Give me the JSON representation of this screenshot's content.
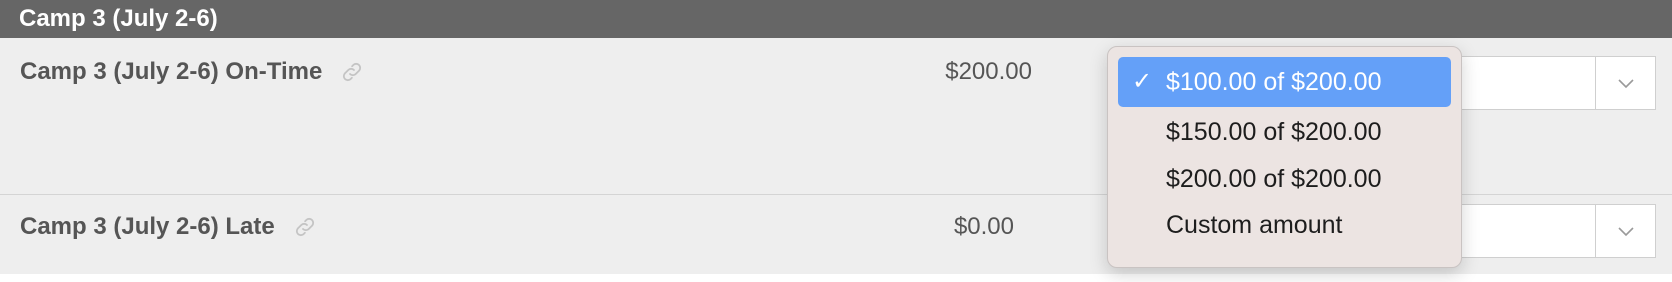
{
  "section": {
    "title": "Camp 3 (July 2-6)"
  },
  "rows": [
    {
      "name": "Camp 3 (July 2-6) On-Time",
      "price": "$200.00"
    },
    {
      "name": "Camp 3 (July 2-6) Late",
      "price": "$0.00"
    }
  ],
  "dropdown": {
    "options": [
      {
        "label": "$100.00 of $200.00",
        "selected": true
      },
      {
        "label": "$150.00 of $200.00",
        "selected": false
      },
      {
        "label": "$200.00 of $200.00",
        "selected": false
      },
      {
        "label": "Custom amount",
        "selected": false
      }
    ],
    "checkmark": "✓"
  },
  "icons": {
    "link": "link-icon",
    "chevron": "chevron-down-icon"
  },
  "colors": {
    "header_bg": "#666666",
    "row_bg": "#eeeeee",
    "selected_bg": "#64a0f8",
    "popup_bg": "#ece4e2"
  }
}
